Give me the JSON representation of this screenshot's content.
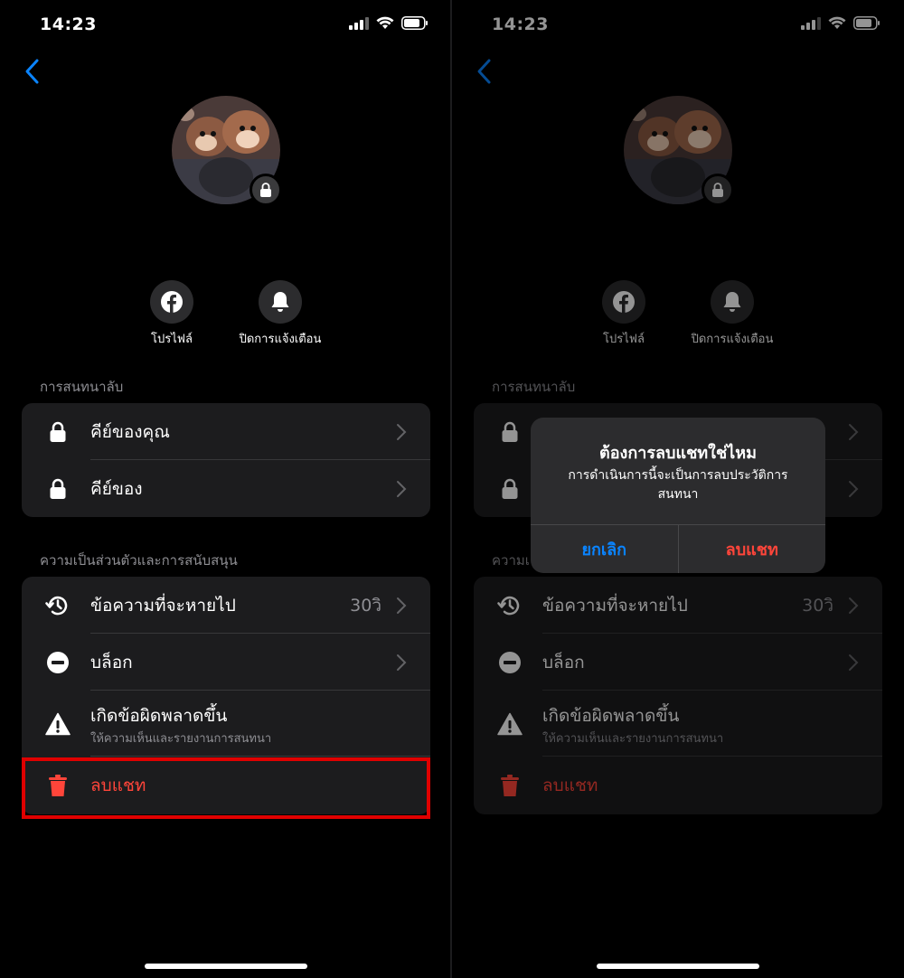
{
  "status": {
    "time": "14:23"
  },
  "profile_actions": {
    "profile_label": "โปรไฟล์",
    "mute_label": "ปิดการแจ้งเตือน"
  },
  "secret_section": {
    "title": "การสนทนาลับ",
    "items": [
      {
        "label": "คีย์ของคุณ",
        "icon": "lock-icon"
      },
      {
        "label": "คีย์ของ",
        "icon": "lock-icon"
      }
    ]
  },
  "privacy_section": {
    "title": "ความเป็นส่วนตัวและการสนับสนุน",
    "items": [
      {
        "label": "ข้อความที่จะหายไป",
        "value": "30วิ",
        "icon": "timer-icon"
      },
      {
        "label": "บล็อก",
        "icon": "block-icon"
      },
      {
        "label": "เกิดข้อผิดพลาดขึ้น",
        "sublabel": "ให้ความเห็นและรายงานการสนทนา",
        "icon": "warning-icon"
      },
      {
        "label": "ลบแชท",
        "icon": "trash-icon"
      }
    ]
  },
  "right_section_title_partial": "ความเ",
  "alert": {
    "title": "ต้องการลบแชทใช่ไหม",
    "message": "การดำเนินการนี้จะเป็นการลบประวัติการสนทนา",
    "cancel": "ยกเลิก",
    "confirm": "ลบแชท"
  },
  "colors": {
    "accent": "#0a84ff",
    "danger": "#ff453a",
    "highlight": "#e00000",
    "card": "#1c1c1e"
  }
}
